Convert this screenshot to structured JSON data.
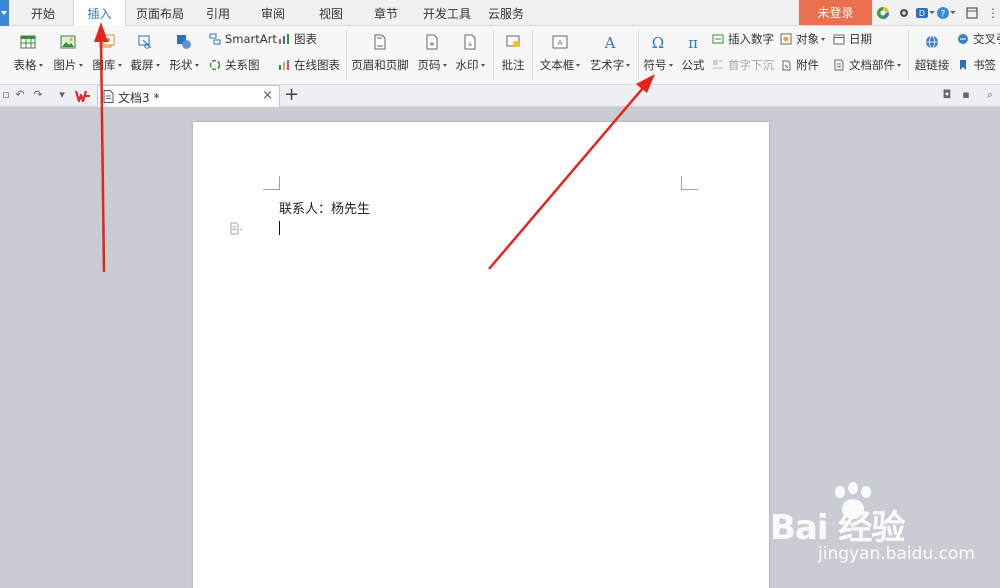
{
  "menu_tabs": [
    {
      "label": "开始"
    },
    {
      "label": "插入"
    },
    {
      "label": "页面布局"
    },
    {
      "label": "引用"
    },
    {
      "label": "审阅"
    },
    {
      "label": "视图"
    },
    {
      "label": "章节"
    },
    {
      "label": "开发工具"
    },
    {
      "label": "云服务"
    }
  ],
  "active_tab": "插入",
  "login_label": "未登录",
  "ribbon": {
    "table": "表格",
    "picture": "图片",
    "gallery": "图库",
    "screenshot": "截屏",
    "shape": "形状",
    "smartart": "SmartArt",
    "relation_chart": "关系图",
    "chart": "图表",
    "online_chart": "在线图表",
    "header_footer": "页眉和页脚",
    "page_number": "页码",
    "watermark": "水印",
    "comment": "批注",
    "textbox": "文本框",
    "wordart": "艺术字",
    "symbol": "符号",
    "formula": "公式",
    "insert_number": "插入数字",
    "drop_cap": "首字下沉",
    "object": "对象",
    "attachment": "附件",
    "date": "日期",
    "doc_parts": "文档部件",
    "hyperlink": "超链接",
    "cross_ref": "交叉引",
    "bookmark": "书签"
  },
  "doc_tab": {
    "title": "文档3 *"
  },
  "document": {
    "contact_line": "联系人：杨先生"
  },
  "watermark": {
    "brand": "Bai 经验",
    "url": "jingyan.baidu.com"
  },
  "colors": {
    "accent": "#2b79c2",
    "login_bg": "#e8704f",
    "arrow": "#e8231e",
    "workspace_bg": "#c9cdd3"
  }
}
